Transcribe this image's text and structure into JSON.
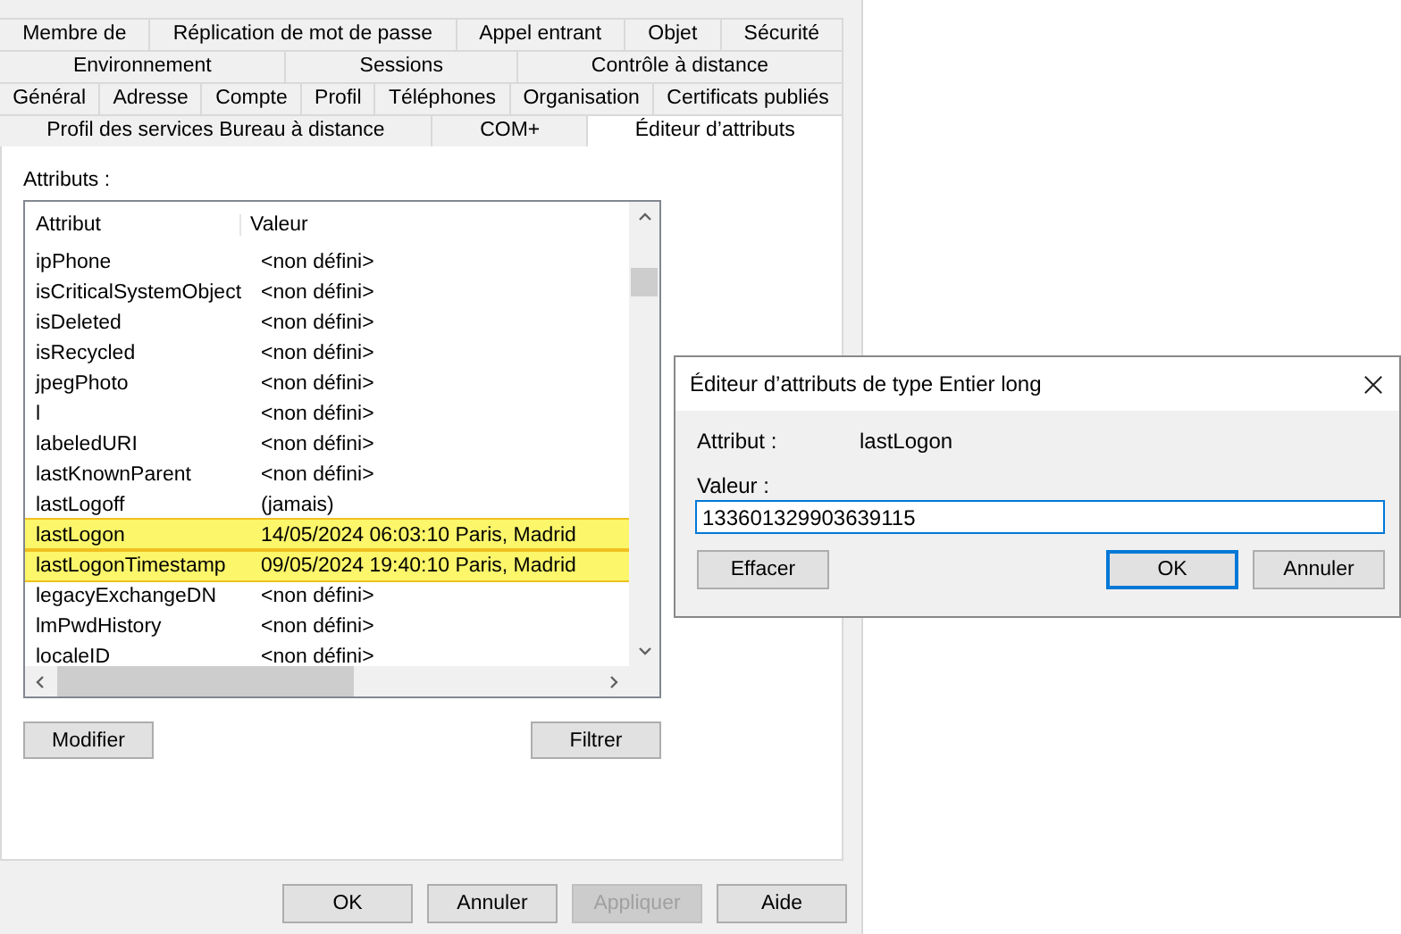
{
  "tab_rows": [
    [
      {
        "label": "Membre de",
        "selected": false
      },
      {
        "label": "Réplication de mot de passe",
        "selected": false
      },
      {
        "label": "Appel entrant",
        "selected": false
      },
      {
        "label": "Objet",
        "selected": false
      },
      {
        "label": "Sécurité",
        "selected": false
      }
    ],
    [
      {
        "label": "Environnement",
        "selected": false
      },
      {
        "label": "Sessions",
        "selected": false
      },
      {
        "label": "Contrôle à distance",
        "selected": false
      }
    ],
    [
      {
        "label": "Général",
        "selected": false
      },
      {
        "label": "Adresse",
        "selected": false
      },
      {
        "label": "Compte",
        "selected": false
      },
      {
        "label": "Profil",
        "selected": false
      },
      {
        "label": "Téléphones",
        "selected": false
      },
      {
        "label": "Organisation",
        "selected": false
      },
      {
        "label": "Certificats publiés",
        "selected": false
      }
    ],
    [
      {
        "label": "Profil des services Bureau à distance",
        "selected": false
      },
      {
        "label": "COM+",
        "selected": false
      },
      {
        "label": "Éditeur d’attributs",
        "selected": true
      }
    ]
  ],
  "attributes_label": "Attributs :",
  "list": {
    "columns": [
      "Attribut",
      "Valeur"
    ],
    "rows": [
      {
        "attribute": "ipPhone",
        "value": "<non défini>",
        "highlighted": false
      },
      {
        "attribute": "isCriticalSystemObject",
        "value": "<non défini>",
        "highlighted": false
      },
      {
        "attribute": "isDeleted",
        "value": "<non défini>",
        "highlighted": false
      },
      {
        "attribute": "isRecycled",
        "value": "<non défini>",
        "highlighted": false
      },
      {
        "attribute": "jpegPhoto",
        "value": "<non défini>",
        "highlighted": false
      },
      {
        "attribute": "l",
        "value": "<non défini>",
        "highlighted": false
      },
      {
        "attribute": "labeledURI",
        "value": "<non défini>",
        "highlighted": false
      },
      {
        "attribute": "lastKnownParent",
        "value": "<non défini>",
        "highlighted": false
      },
      {
        "attribute": "lastLogoff",
        "value": "(jamais)",
        "highlighted": false
      },
      {
        "attribute": "lastLogon",
        "value": "14/05/2024 06:03:10 Paris, Madrid",
        "highlighted": true
      },
      {
        "attribute": "lastLogonTimestamp",
        "value": "09/05/2024 19:40:10 Paris, Madrid",
        "highlighted": true
      },
      {
        "attribute": "legacyExchangeDN",
        "value": "<non défini>",
        "highlighted": false
      },
      {
        "attribute": "lmPwdHistory",
        "value": "<non défini>",
        "highlighted": false
      },
      {
        "attribute": "localeID",
        "value": "<non défini>",
        "highlighted": false
      }
    ]
  },
  "list_buttons": [
    "Modifier",
    "Filtrer"
  ],
  "footer_buttons": [
    {
      "label": "OK",
      "disabled": false
    },
    {
      "label": "Annuler",
      "disabled": false
    },
    {
      "label": "Appliquer",
      "disabled": true
    },
    {
      "label": "Aide",
      "disabled": false
    }
  ],
  "dialog": {
    "title": "Éditeur d’attributs de type Entier long",
    "attribute_label": "Attribut :",
    "attribute_value": "lastLogon",
    "value_label": "Valeur :",
    "value": "133601329903639115",
    "buttons": [
      {
        "label": "Effacer",
        "default": false
      },
      {
        "label": "OK",
        "default": true
      },
      {
        "label": "Annuler",
        "default": false
      }
    ]
  }
}
